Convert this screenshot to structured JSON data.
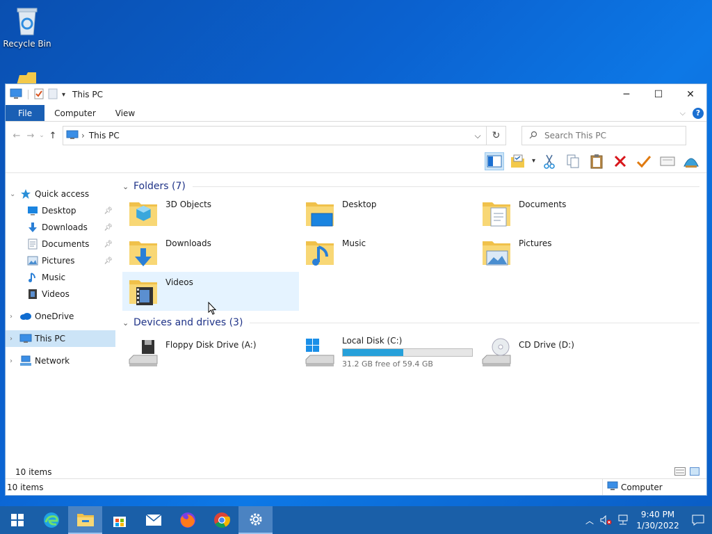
{
  "desktop": {
    "recycle_bin_label": "Recycle Bin"
  },
  "window": {
    "title": "This PC"
  },
  "ribbon": {
    "tabs": [
      "File",
      "Computer",
      "View"
    ],
    "help": "?"
  },
  "address": {
    "path": "This PC",
    "search_placeholder": "Search This PC"
  },
  "nav": {
    "quick_access": "Quick access",
    "quick_items": [
      "Desktop",
      "Downloads",
      "Documents",
      "Pictures",
      "Music",
      "Videos"
    ],
    "onedrive": "OneDrive",
    "this_pc": "This PC",
    "network": "Network"
  },
  "folders": {
    "header": "Folders (7)",
    "items": [
      "3D Objects",
      "Desktop",
      "Documents",
      "Downloads",
      "Music",
      "Pictures",
      "Videos"
    ]
  },
  "drives": {
    "header": "Devices and drives (3)",
    "floppy": "Floppy Disk Drive (A:)",
    "local": {
      "label": "Local Disk (C:)",
      "free_text": "31.2 GB free of 59.4 GB",
      "used_fraction": 0.47
    },
    "cd": "CD Drive (D:)"
  },
  "status": {
    "items_inner": "10 items",
    "items": "10 items",
    "computer": "Computer"
  },
  "taskbar": {
    "time": "9:40 PM",
    "date": "1/30/2022"
  },
  "colors": {
    "accent": "#1a5fb4",
    "selection": "#cce4f7",
    "drive_bar": "#26a0da",
    "taskbar": "#1a5fa8"
  }
}
